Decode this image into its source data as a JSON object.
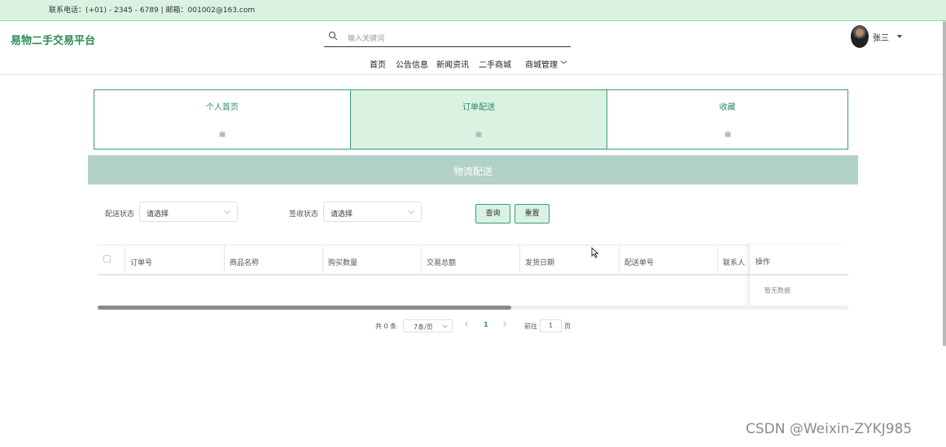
{
  "topbar": {
    "contact": "联系电话：(+01) - 2345 - 6789 | 邮箱：001002@163.com"
  },
  "header": {
    "logo": "易物二手交易平台",
    "search_placeholder": "输入关键词",
    "nav": [
      "首页",
      "公告信息",
      "新闻资讯",
      "二手商城",
      "商城管理"
    ],
    "user": "张三"
  },
  "tabs": [
    {
      "label": "个人首页",
      "active": false
    },
    {
      "label": "订单配送",
      "active": true
    },
    {
      "label": "收藏",
      "active": false
    }
  ],
  "banner": {
    "title": "物流配送"
  },
  "filters": {
    "delivery_status_label": "配送状态",
    "delivery_status_value": "请选择",
    "receipt_status_label": "签收状态",
    "receipt_status_value": "请选择",
    "query_button": "查询",
    "reset_button": "重置"
  },
  "table": {
    "columns": [
      "订单号",
      "商品名称",
      "购买数量",
      "交易总额",
      "发货日期",
      "配送单号",
      "联系人"
    ],
    "action_column": "操作",
    "empty_text": "暂无数据"
  },
  "pagination": {
    "total": "共 0 条",
    "page_size": "7条/页",
    "current_page": "1",
    "goto_label": "前往",
    "goto_value": "1",
    "goto_unit": "页"
  },
  "watermark": "CSDN @Weixin-ZYKJ985",
  "colors": {
    "accent": "#2e8b6e",
    "topbar_bg": "#d9f2e1",
    "banner_bg": "#b2d1c7"
  }
}
